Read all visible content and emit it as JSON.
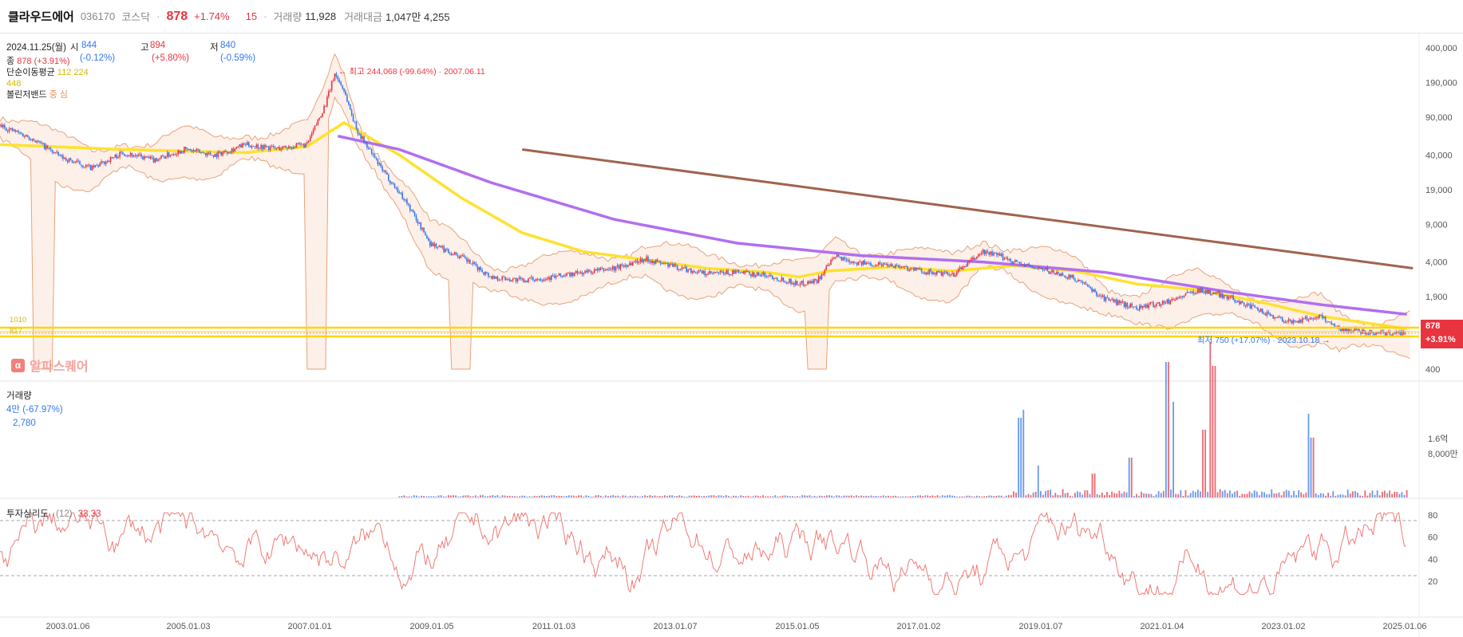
{
  "header": {
    "name": "클라우드에어",
    "code": "036170",
    "market": "코스닥",
    "price": "878",
    "change_pct": "+1.74%",
    "change": "15",
    "volume_label": "거래량",
    "volume_value": "11,928",
    "amount_label": "거래대금",
    "amount_value": "1,047만 4,255"
  },
  "ohlc": {
    "date": "2024.11.25(월)",
    "open_label": "시",
    "open": "844",
    "open_pct": "(-0.12%)",
    "high_label": "고",
    "high": "894",
    "high_pct": "(+5.80%)",
    "low_label": "저",
    "low": "840",
    "low_pct": "(-0.59%)",
    "close_label": "종",
    "close": "878",
    "close_pct": "(+3.91%)"
  },
  "price_legend": {
    "ma_label": "단순이동평균",
    "ma_value": "112 224 448",
    "bb_label": "볼린저밴드",
    "bb_value": "중 심"
  },
  "annotations": {
    "high_note": "← 최고 244,068 (-99.64%) · 2007.06.11",
    "low_note": "최저 750 (+17.07%) · 2023.10.18 →",
    "level_1010": "1010",
    "level_817": "817"
  },
  "price_tag": {
    "price": "878",
    "pct": "+3.91%"
  },
  "watermark": {
    "icon": "alpha-square-icon",
    "text": "알파스퀘어"
  },
  "volume_legend": {
    "label": "거래량",
    "value": "4만",
    "pct": "(-67.97%)",
    "ma": "2,780"
  },
  "rsi_legend": {
    "label": "투자심리도",
    "period": "(12)",
    "value": "33.33"
  },
  "colors": {
    "up": "#e8343f",
    "down": "#3377ee",
    "ma_yellow": "#ffe12e",
    "ma_purple": "#b26ef0",
    "trend_brown": "#a0634e",
    "band": "#e8a27a",
    "rsi": "#f07b76"
  },
  "chart_data": {
    "type": "line",
    "x_ticks": [
      "2003.01.06",
      "2005.01.03",
      "2007.01.01",
      "2009.01.05",
      "2011.01.03",
      "2013.01.07",
      "2015.01.05",
      "2017.01.02",
      "2019.01.07",
      "2021.01.04",
      "2023.01.02",
      "2025.01.06"
    ],
    "price_axis": {
      "scale": "log",
      "ticks": [
        "400,000",
        "190,000",
        "90,000",
        "40,000",
        "19,000",
        "9,000",
        "4,000",
        "1,900",
        "400"
      ]
    },
    "volume_axis": {
      "ticks": [
        "1.6억",
        "8,000만"
      ]
    },
    "rsi_axis": {
      "ticks": [
        "80",
        "60",
        "40",
        "20"
      ],
      "guides": [
        75,
        25
      ]
    },
    "series": [
      {
        "name": "종가",
        "x": [
          2002.0,
          2002.5,
          2003.0,
          2003.5,
          2004.0,
          2004.5,
          2005.0,
          2005.5,
          2006.0,
          2006.5,
          2007.0,
          2007.3,
          2007.45,
          2007.6,
          2007.8,
          2008.2,
          2008.6,
          2009.0,
          2009.5,
          2010.0,
          2010.5,
          2011.0,
          2011.5,
          2012.0,
          2012.5,
          2013.0,
          2013.5,
          2014.0,
          2014.5,
          2015.0,
          2015.3,
          2015.6,
          2016.0,
          2016.5,
          2017.0,
          2017.5,
          2018.0,
          2018.3,
          2018.7,
          2019.0,
          2019.5,
          2020.0,
          2020.5,
          2021.0,
          2021.5,
          2022.0,
          2022.5,
          2023.0,
          2023.5,
          2023.8,
          2024.2,
          2024.6,
          2024.9
        ],
        "y": [
          75000,
          58000,
          38000,
          30000,
          42000,
          36000,
          45000,
          40000,
          50000,
          46000,
          50000,
          120000,
          230000,
          160000,
          70000,
          30000,
          15000,
          6000,
          4500,
          2900,
          2700,
          2900,
          3200,
          3500,
          4300,
          3600,
          3100,
          3200,
          3000,
          2500,
          2700,
          4500,
          3900,
          3800,
          3300,
          3000,
          5000,
          4500,
          3700,
          3400,
          2800,
          1800,
          1500,
          1700,
          2200,
          1900,
          1400,
          1100,
          1250,
          950,
          900,
          860,
          878
        ]
      },
      {
        "name": "112",
        "x": [
          2002.0,
          2004.0,
          2006.0,
          2007.0,
          2007.6,
          2008.5,
          2009.5,
          2010.5,
          2011.5,
          2012.5,
          2013.5,
          2014.5,
          2015.0,
          2015.5,
          2016.5,
          2017.5,
          2018.5,
          2019.5,
          2020.5,
          2021.5,
          2022.5,
          2023.5,
          2024.9
        ],
        "y": [
          50000,
          45000,
          42000,
          48000,
          80000,
          40000,
          16000,
          7500,
          5000,
          4200,
          3500,
          3200,
          2900,
          3300,
          3600,
          3300,
          3700,
          3300,
          2500,
          2200,
          1700,
          1250,
          950
        ]
      },
      {
        "name": "224",
        "x": [
          2007.5,
          2008.5,
          2010.0,
          2012.0,
          2014.0,
          2016.0,
          2018.0,
          2020.0,
          2022.0,
          2023.5,
          2024.9
        ],
        "y": [
          60000,
          45000,
          22000,
          10000,
          6000,
          4600,
          4000,
          3200,
          2100,
          1600,
          1300
        ]
      }
    ],
    "trend_line": {
      "x": [
        2010.5,
        2025.0
      ],
      "y": [
        45000,
        3500
      ]
    },
    "bb_lower_spikes": [
      {
        "x": 2002.7,
        "y": 400
      },
      {
        "x": 2007.15,
        "y": 400
      },
      {
        "x": 2009.5,
        "y": 400
      },
      {
        "x": 2015.3,
        "y": 400
      }
    ]
  }
}
